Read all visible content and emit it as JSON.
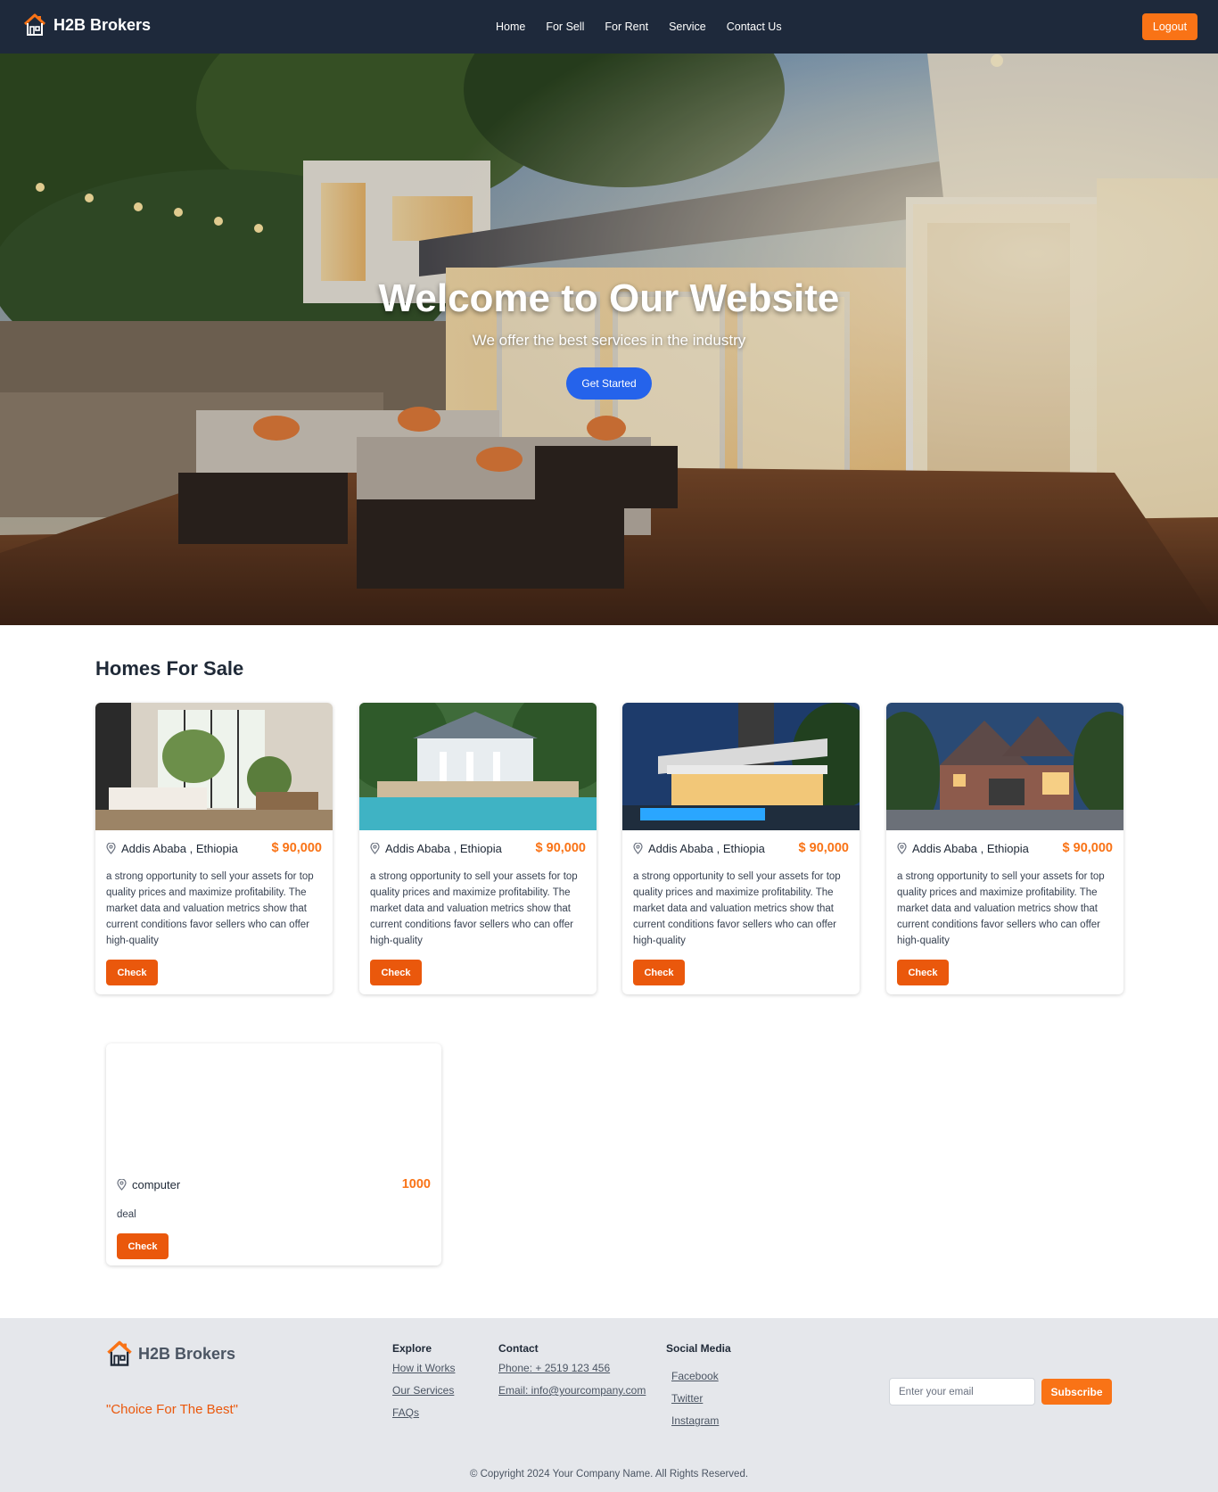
{
  "navbar": {
    "brand": "H2B Brokers",
    "links": [
      "Home",
      "For Sell",
      "For Rent",
      "Service",
      "Contact Us"
    ],
    "logout_label": "Logout"
  },
  "hero": {
    "title": "Welcome to Our Website",
    "subtitle": "We offer the best services in the industry",
    "cta_label": "Get Started"
  },
  "homes_section": {
    "title": "Homes For Sale",
    "cards": [
      {
        "location": "Addis Ababa , Ethiopia",
        "price": "$ 90,000",
        "description": "a strong opportunity to sell your assets for top quality prices and maximize profitability. The market data and valuation metrics show that current conditions favor sellers who can offer high-quality",
        "button": "Check"
      },
      {
        "location": "Addis Ababa , Ethiopia",
        "price": "$ 90,000",
        "description": "a strong opportunity to sell your assets for top quality prices and maximize profitability. The market data and valuation metrics show that current conditions favor sellers who can offer high-quality",
        "button": "Check"
      },
      {
        "location": "Addis Ababa , Ethiopia",
        "price": "$ 90,000",
        "description": "a strong opportunity to sell your assets for top quality prices and maximize profitability. The market data and valuation metrics show that current conditions favor sellers who can offer high-quality",
        "button": "Check"
      },
      {
        "location": "Addis Ababa , Ethiopia",
        "price": "$ 90,000",
        "description": "a strong opportunity to sell your assets for top quality prices and maximize profitability. The market data and valuation metrics show that current conditions favor sellers who can offer high-quality",
        "button": "Check"
      }
    ],
    "extra_card": {
      "location": "computer",
      "price": "1000",
      "description": "deal",
      "button": "Check"
    }
  },
  "footer": {
    "brand": "H2B Brokers",
    "tagline": "\"Choice For The Best\"",
    "explore": {
      "title": "Explore",
      "links": [
        "How it Works",
        "Our Services",
        "FAQs"
      ]
    },
    "contact": {
      "title": "Contact",
      "links": [
        "Phone: + 2519 123 456",
        "Email: info@yourcompany.com"
      ]
    },
    "social": {
      "title": "Social Media",
      "links": [
        "Facebook",
        "Twitter",
        "Instagram"
      ]
    },
    "email_placeholder": "Enter your email",
    "subscribe_label": "Subscribe",
    "copyright": "© Copyright 2024 Your Company Name. All Rights Reserved."
  },
  "colors": {
    "nav_bg": "#1e293b",
    "accent_orange": "#f97316",
    "check_orange": "#ea580c",
    "cta_blue": "#2563eb",
    "footer_bg": "#e5e7eb"
  },
  "icons": [
    "house-logo-icon",
    "map-pin-icon"
  ]
}
